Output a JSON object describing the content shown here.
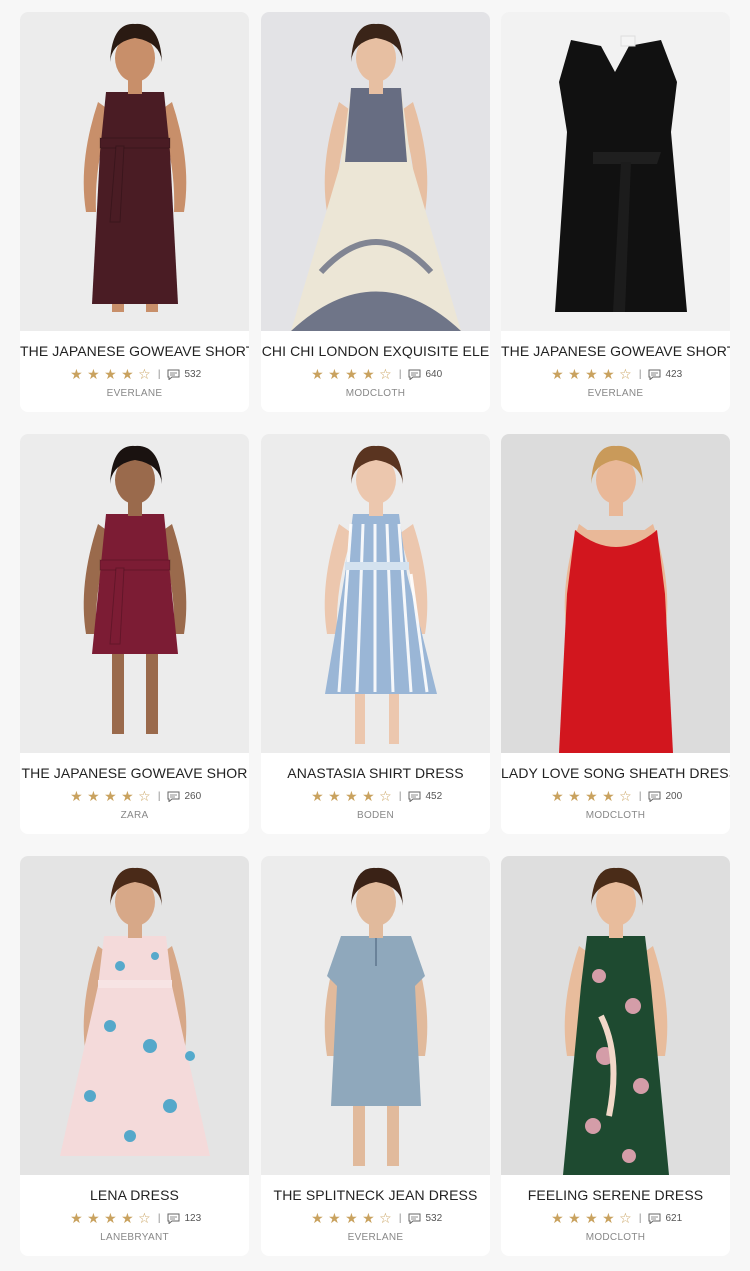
{
  "products": [
    {
      "title": "THE JAPANESE GOWEAVE SHORT",
      "rating": 4,
      "comments": "532",
      "brand": "EVERLANE",
      "bg": "#ececec",
      "dress": "#4a1c24",
      "skin": "#c88f6a",
      "hair": "#2a1a12",
      "style": "belted"
    },
    {
      "title": "CHI CHI LONDON EXQUISITE ELE",
      "rating": 4,
      "comments": "640",
      "brand": "MODCLOTH",
      "bg": "#e3e3e6",
      "dress": "#ece6d6",
      "skin": "#e7bfa2",
      "hair": "#3a2418",
      "style": "lace"
    },
    {
      "title": "THE JAPANESE GOWEAVE SHORT",
      "rating": 4,
      "comments": "423",
      "brand": "EVERLANE",
      "bg": "#f2f2f2",
      "dress": "#111111",
      "skin": "none",
      "hair": "none",
      "style": "flat"
    },
    {
      "title": "THE JAPANESE GOWEAVE SHOR",
      "rating": 4,
      "comments": "260",
      "brand": "ZARA",
      "bg": "#ececec",
      "dress": "#7c1c34",
      "skin": "#9a6a4c",
      "hair": "#1a1210",
      "style": "belted-short"
    },
    {
      "title": "ANASTASIA SHIRT DRESS",
      "rating": 4,
      "comments": "452",
      "brand": "BODEN",
      "bg": "#ececec",
      "dress": "#9ab6d6",
      "skin": "#ecc7ae",
      "hair": "#5a3420",
      "style": "stripe"
    },
    {
      "title": "LADY LOVE SONG SHEATH DRESS",
      "rating": 4,
      "comments": "200",
      "brand": "MODCLOTH",
      "bg": "#dcdcdc",
      "dress": "#d2161e",
      "skin": "#e9b898",
      "hair": "#c99a5a",
      "style": "sheath"
    },
    {
      "title": "LENA DRESS",
      "rating": 4,
      "comments": "123",
      "brand": "LANEBRYANT",
      "bg": "#e4e4e4",
      "dress": "#f4dada",
      "skin": "#d7a888",
      "hair": "#4a2a18",
      "style": "floral-pink"
    },
    {
      "title": "THE SPLITNECK JEAN DRESS",
      "rating": 4,
      "comments": "532",
      "brand": "EVERLANE",
      "bg": "#ececec",
      "dress": "#8fa8bc",
      "skin": "#e1ba9c",
      "hair": "#3a2216",
      "style": "shift"
    },
    {
      "title": "FEELING SERENE DRESS",
      "rating": 4,
      "comments": "621",
      "brand": "MODCLOTH",
      "bg": "#dedede",
      "dress": "#1e4a30",
      "skin": "#e8bc9c",
      "hair": "#4a2c18",
      "style": "floral-green"
    }
  ]
}
